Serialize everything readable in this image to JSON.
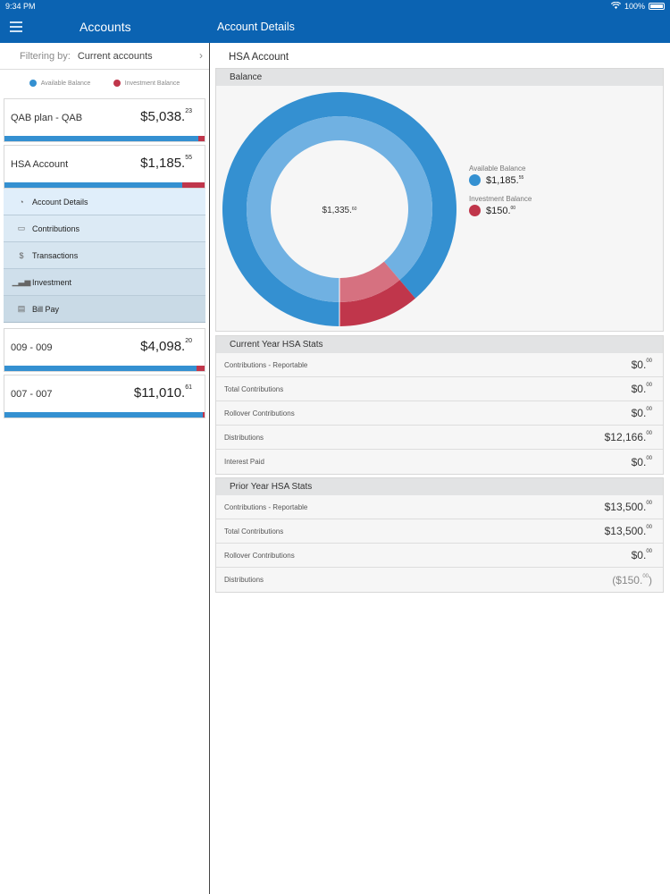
{
  "status": {
    "time": "9:34 PM",
    "battery": "100%"
  },
  "nav": {
    "left_title": "Accounts",
    "right_title": "Account Details"
  },
  "filter": {
    "label": "Filtering by:",
    "value": "Current accounts"
  },
  "legend": {
    "available": "Available Balance",
    "investment": "Investment Balance",
    "available_color": "#3490d1",
    "investment_color": "#c0364b"
  },
  "accounts": [
    {
      "name": "QAB plan - QAB",
      "amount": "$5,038.",
      "cents": "23",
      "available_fraction": 0.97
    },
    {
      "name": "HSA Account",
      "amount": "$1,185.",
      "cents": "55",
      "available_fraction": 0.89
    },
    {
      "name": "009 - 009",
      "amount": "$4,098.",
      "cents": "20",
      "available_fraction": 0.96
    },
    {
      "name": "007 - 007",
      "amount": "$11,010.",
      "cents": "61",
      "available_fraction": 0.99
    }
  ],
  "submenu": [
    {
      "label": "Account Details",
      "icon": "gauge-icon"
    },
    {
      "label": "Contributions",
      "icon": "cash-icon"
    },
    {
      "label": "Transactions",
      "icon": "dollar-icon"
    },
    {
      "label": "Investment",
      "icon": "bar-chart-icon"
    },
    {
      "label": "Bill Pay",
      "icon": "bill-icon"
    }
  ],
  "details": {
    "title": "HSA Account",
    "balance_header": "Balance",
    "total": "$1,335.",
    "total_cents": "60",
    "available_label": "Available Balance",
    "available_value": "$1,185.",
    "available_cents": "55",
    "investment_label": "Investment Balance",
    "investment_value": "$150.",
    "investment_cents": "00"
  },
  "chart_data": {
    "type": "pie",
    "categories": [
      "Available Balance",
      "Investment Balance"
    ],
    "values": [
      1185.55,
      150.0
    ],
    "colors": [
      "#3490d1",
      "#c0364b"
    ]
  },
  "current_stats": {
    "header": "Current Year HSA Stats",
    "rows": [
      {
        "label": "Contributions - Reportable",
        "value": "$0.",
        "cents": "00"
      },
      {
        "label": "Total Contributions",
        "value": "$0.",
        "cents": "00"
      },
      {
        "label": "Rollover Contributions",
        "value": "$0.",
        "cents": "00"
      },
      {
        "label": "Distributions",
        "value": "$12,166.",
        "cents": "00"
      },
      {
        "label": "Interest Paid",
        "value": "$0.",
        "cents": "00"
      }
    ]
  },
  "prior_stats": {
    "header": "Prior Year HSA Stats",
    "rows": [
      {
        "label": "Contributions - Reportable",
        "value": "$13,500.",
        "cents": "00"
      },
      {
        "label": "Total Contributions",
        "value": "$13,500.",
        "cents": "00"
      },
      {
        "label": "Rollover Contributions",
        "value": "$0.",
        "cents": "00"
      },
      {
        "label": "Distributions",
        "value": "($150.",
        "cents": "00",
        "suffix": ")"
      }
    ]
  }
}
